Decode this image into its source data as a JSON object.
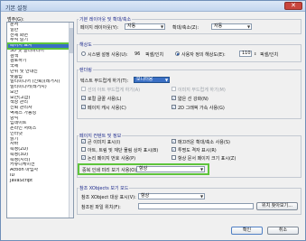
{
  "window": {
    "title": "기본 설정",
    "close_icon": "close-icon"
  },
  "categories": {
    "label": "범주(G):",
    "items": [
      "문서",
      "일반",
      "전체 화면",
      "주석 달기",
      "페이지 표시",
      "3D 및 멀티미디어",
      "검색",
      "검토하기",
      "국제",
      "단위 및 안내선",
      "맞춤법",
      "멀티미디어 (신뢰)(레거시)",
      "멀티미디어(레거시)",
      "보안",
      "보안(고급)",
      "색상 관리",
      "신뢰 관리자",
      "액세스 가능성",
      "양식",
      "업데이트",
      "온라인 서비스",
      "인터넷",
      "읽기",
      "자바",
      "측정(2D)",
      "측정(3D)",
      "측정(지리)",
      "커뮤니케이션",
      "Action 마법사",
      "ID",
      "JavaScript"
    ],
    "selected_index": 4
  },
  "default_layout": {
    "title": "기본 레이아웃 및 확대/축소",
    "layout_label": "페이지 레이아웃(Y):",
    "layout_value": "자동",
    "zoom_label": "확대/축소(Z):",
    "zoom_value": "자동"
  },
  "resolution": {
    "title": "해상도",
    "system_label": "시스템 설정 사용(U):",
    "system_value": "96",
    "system_unit": "픽셀/인치",
    "custom_label": "사용자 정의 해상도(E):",
    "custom_value": "110",
    "custom_unit": "픽셀/인치"
  },
  "rendering": {
    "title": "렌더링",
    "smooth_text_label": "텍스트 부드럽게 하기(T):",
    "smooth_text_value": "모니터용",
    "smooth_lineart": "선의 아트 부드럽게 하기(A)",
    "smooth_images": "이미지 부드럽게 하기(M)",
    "local_fonts": "로컬 글꼴 사용(L)",
    "thin_lines": "얇은 선 강화(N)",
    "page_cache": "페이지 캐시 사용(C)",
    "accel_2d": "2D 그래픽 가속 사용(G)"
  },
  "page_content": {
    "title": "페이지 컨텐트 및 정보",
    "large_images": "큰 이미지 표시(I)",
    "smooth_zoom": "매끄러운 확대/축소 사용(S)",
    "art_boxes": "아트, 트림 및 재단 물림 상자 표시(B)",
    "transparency_grid": "투명도 격자 표시(R)",
    "logical_order": "논리 페이지 번호 사용(P)",
    "doc_size": "항상 문서 페이지 크기 표시(Z)",
    "overprint_label": "중복 인쇄 미리 보기 사용(O):",
    "overprint_value": "항상"
  },
  "ref_xobjects": {
    "title": "참조 XObjects 보기 모드",
    "targets_label": "참조 XObject 대상 표시(V):",
    "targets_value": "항상",
    "location_label": "참조된 파일 위치(F):",
    "browse_label": "위치 찾아보기..."
  },
  "buttons": {
    "ok": "확인",
    "cancel": "취소"
  }
}
